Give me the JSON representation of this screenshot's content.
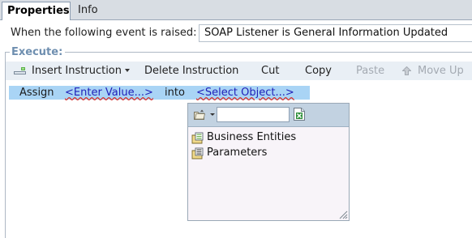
{
  "tabs": [
    {
      "label": "Properties",
      "active": true
    },
    {
      "label": "Info",
      "active": false
    }
  ],
  "event": {
    "label": "When the following event is raised:",
    "value": "SOAP Listener is General Information Updated"
  },
  "execute": {
    "group_title": "Execute:",
    "toolbar": {
      "insert_instruction": "Insert Instruction",
      "delete_instruction": "Delete Instruction",
      "cut": "Cut",
      "copy": "Copy",
      "paste": "Paste",
      "move_up": "Move Up"
    },
    "instruction": {
      "keyword": "Assign",
      "value_link": "<Enter Value...>",
      "connector": "into",
      "object_link": "<Select Object...>"
    }
  },
  "object_picker": {
    "search_value": "",
    "items": [
      {
        "label": "Business Entities",
        "icon": "business-entities-icon"
      },
      {
        "label": "Parameters",
        "icon": "parameters-icon"
      }
    ]
  },
  "colors": {
    "tab_strip": "#d8dde3",
    "toolbar_bg": "#e9eff5",
    "selected_row": "#a9d4f5",
    "group_title": "#6f8fb0",
    "link": "#1f1fb8",
    "popup_bg": "#f8f4f9",
    "popup_toolbar": "#c2d2e1"
  }
}
